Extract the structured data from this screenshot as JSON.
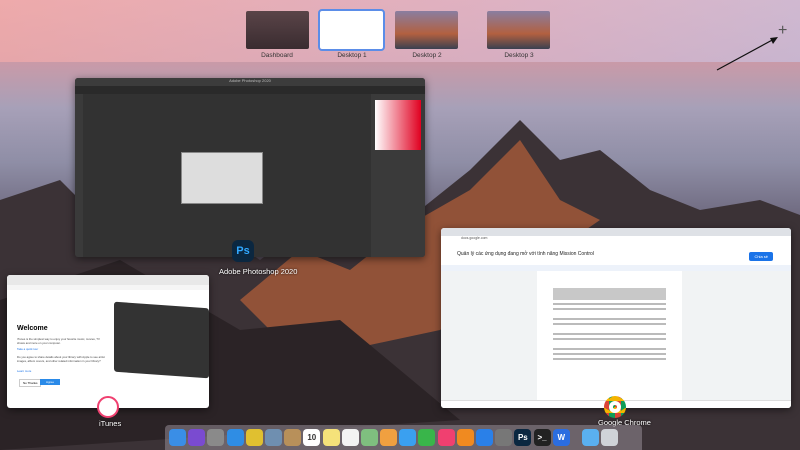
{
  "spaces": [
    {
      "label": "Dashboard"
    },
    {
      "label": "Desktop 1",
      "selected": true
    },
    {
      "label": "Desktop 2"
    },
    {
      "label": "Desktop 3"
    }
  ],
  "add_space_icon": "plus-icon",
  "windows": {
    "photoshop": {
      "label": "Adobe Photoshop 2020",
      "title": "Adobe Photoshop 2020",
      "icon_text": "Ps"
    },
    "chrome": {
      "label": "Google Chrome",
      "doc_title": "Quản lý các ứng dụng đang mở với tính năng Mission Control",
      "share": "Chia sẻ",
      "url": "docs.google.com"
    },
    "itunes": {
      "label": "iTunes",
      "welcome": "Welcome",
      "body": "iTunes is the simplest way to enjoy your favorite music, movies, TV shows and more on your computer.",
      "tour": "Take a quick tour",
      "body2": "Do you agree to share details about your library with Apple to see artist images, album covers, and other related information in your library?",
      "learn": "Learn more",
      "no_thanks": "No Thanks",
      "agree": "Agree"
    }
  },
  "dock": [
    {
      "name": "finder",
      "color": "#3a8ee6"
    },
    {
      "name": "siri",
      "color": "#7a4bd0"
    },
    {
      "name": "launchpad",
      "color": "#8a8a8a"
    },
    {
      "name": "safari",
      "color": "#2f8de4"
    },
    {
      "name": "chrome",
      "color": "#e0c030"
    },
    {
      "name": "preview",
      "color": "#6f8fb0"
    },
    {
      "name": "notefile",
      "color": "#b8905a"
    },
    {
      "name": "calendar",
      "color": "#ffffff",
      "text": "10"
    },
    {
      "name": "notes",
      "color": "#f5e27a"
    },
    {
      "name": "reminders",
      "color": "#f3f3f3"
    },
    {
      "name": "maps",
      "color": "#7fbf7f"
    },
    {
      "name": "photos",
      "color": "#f0a040"
    },
    {
      "name": "messages",
      "color": "#3aa0f0"
    },
    {
      "name": "facetime",
      "color": "#39b54a"
    },
    {
      "name": "music",
      "color": "#f04070"
    },
    {
      "name": "books",
      "color": "#f08a20"
    },
    {
      "name": "app-store",
      "color": "#2a80e8"
    },
    {
      "name": "system-preferences",
      "color": "#777"
    },
    {
      "name": "photoshop",
      "color": "#0b2740",
      "text": "Ps"
    },
    {
      "name": "terminal",
      "color": "#222",
      "text": ">_"
    },
    {
      "name": "wps",
      "color": "#2b6de0",
      "text": "W"
    },
    {
      "name": "downloads",
      "color": "#5ab0f0"
    },
    {
      "name": "trash",
      "color": "#cfd3d8"
    }
  ]
}
